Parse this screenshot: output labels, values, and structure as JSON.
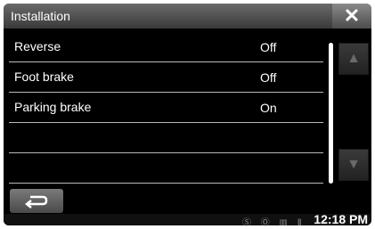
{
  "window": {
    "title": "Installation",
    "close_icon": "✕"
  },
  "settings": [
    {
      "label": "Reverse",
      "value": "Off"
    },
    {
      "label": "Foot brake",
      "value": "Off"
    },
    {
      "label": "Parking brake",
      "value": "On"
    },
    {
      "label": "",
      "value": ""
    },
    {
      "label": "",
      "value": ""
    }
  ],
  "scroll": {
    "up_icon": "▲",
    "down_icon": "▼"
  },
  "footer": {
    "back_icon": "back-arrow-icon"
  },
  "status": {
    "icons": "Ⓢ Ⓞ ▥ Ⅱ",
    "time": "12:18 PM"
  }
}
